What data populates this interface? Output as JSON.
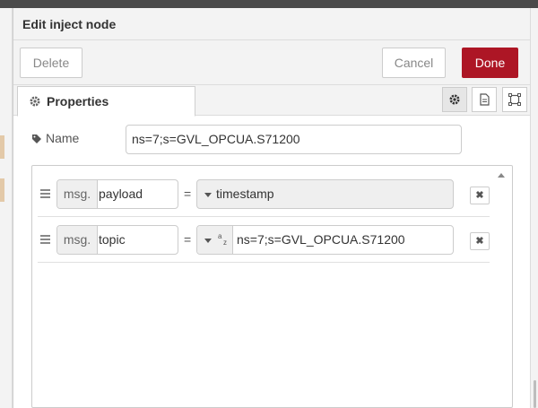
{
  "dialog": {
    "title": "Edit inject node",
    "delete_label": "Delete",
    "cancel_label": "Cancel",
    "done_label": "Done"
  },
  "tabs": [
    {
      "label": "Properties",
      "icon": "gear-icon",
      "active": true
    }
  ],
  "tab_icons": [
    "gear-icon",
    "description-icon",
    "appearance-icon"
  ],
  "form": {
    "name_label": "Name",
    "name_value": "ns=7;s=GVL_OPCUA.S71200"
  },
  "properties": [
    {
      "prefix": "msg.",
      "property": "payload",
      "operator": "=",
      "type": "timestamp",
      "value": "timestamp"
    },
    {
      "prefix": "msg.",
      "property": "topic",
      "operator": "=",
      "type": "a/z",
      "value": "ns=7;s=GVL_OPCUA.S71200"
    }
  ],
  "colors": {
    "accent": "#ad1625",
    "header_bg": "#f3f3f3",
    "border": "#cccccc"
  }
}
